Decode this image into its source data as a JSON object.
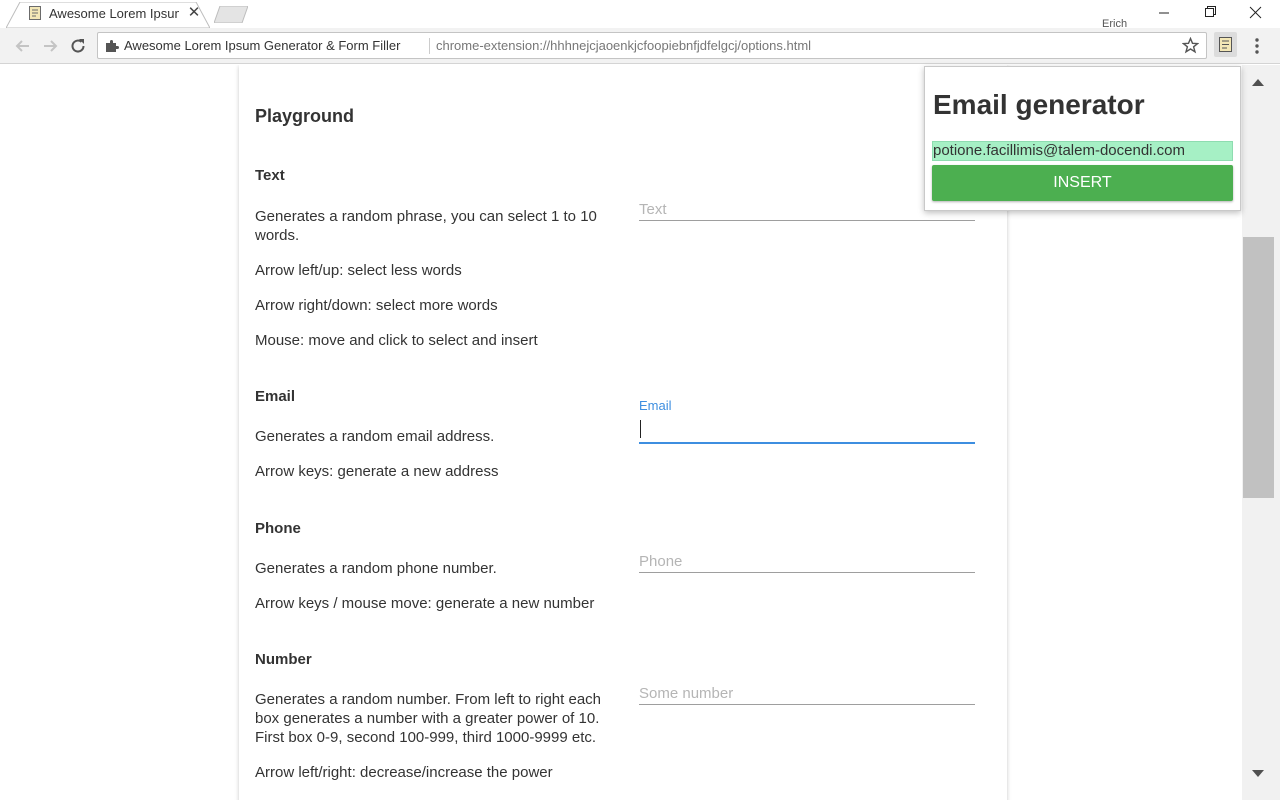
{
  "browser": {
    "tab_title": "Awesome Lorem Ipsum G",
    "tab_close": "✕",
    "profile_name": "Erich",
    "omnibox_title": "Awesome Lorem Ipsum Generator & Form Filler",
    "omnibox_url": "chrome-extension://hhhnejcjaoenkjcfoopiebnfjdfelgcj/options.html"
  },
  "page": {
    "title": "Playground",
    "sections": [
      {
        "title": "Text",
        "descriptions": [
          "Generates a random phrase, you can select 1 to 10 words.",
          "Arrow left/up: select less words",
          "Arrow right/down: select more words",
          "Mouse: move and click to select and insert"
        ],
        "placeholder": "Text"
      },
      {
        "title": "Email",
        "descriptions": [
          "Generates a random email address.",
          "Arrow keys: generate a new address"
        ],
        "label": "Email",
        "value": ""
      },
      {
        "title": "Phone",
        "descriptions": [
          "Generates a random phone number.",
          "Arrow keys / mouse move: generate a new number"
        ],
        "placeholder": "Phone"
      },
      {
        "title": "Number",
        "descriptions": [
          "Generates a random number. From left to right each box generates a number with a greater power of 10. First box 0-9, second 100-999, third 1000-9999 etc.",
          "Arrow left/right: decrease/increase the power"
        ],
        "placeholder": "Some number"
      }
    ]
  },
  "popup": {
    "title": "Email generator",
    "email": "potione.facillimis@talem-docendi.com",
    "insert_label": "INSERT"
  },
  "colors": {
    "accent": "#3d8ee0",
    "insert_button": "#4caf50",
    "email_highlight": "#a6f0c5"
  },
  "icons": [
    "extension-favicon",
    "close-icon",
    "back-arrow-icon",
    "forward-arrow-icon",
    "reload-icon",
    "puzzle-icon",
    "star-icon",
    "chrome-menu-icon",
    "minimize-icon",
    "maximize-icon",
    "window-close-icon"
  ]
}
